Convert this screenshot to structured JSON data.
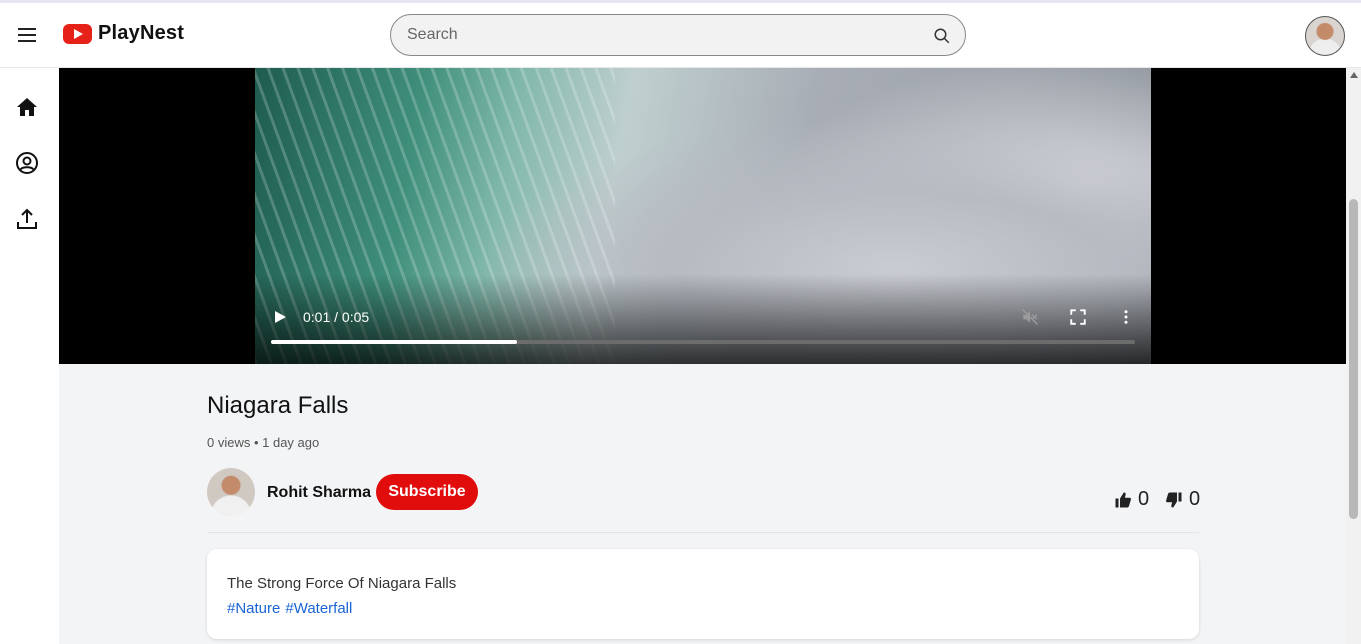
{
  "header": {
    "app_name": "PlayNest",
    "search_placeholder": "Search",
    "icons": [
      "menu-icon",
      "playnest-logo-icon",
      "search-icon",
      "user-avatar"
    ]
  },
  "sidebar": {
    "items": [
      {
        "icon": "home-icon"
      },
      {
        "icon": "profile-icon"
      },
      {
        "icon": "upload-icon"
      }
    ]
  },
  "player": {
    "time_display": "0:01 / 0:05",
    "progress": 0.285,
    "muted": true,
    "controls": [
      "play-icon",
      "mute-icon",
      "fullscreen-icon",
      "more-options-icon"
    ]
  },
  "video": {
    "title": "Niagara Falls",
    "meta": "0 views • 1 day ago",
    "channel_name": "Rohit Sharma",
    "subscribe_label": "Subscribe",
    "likes": "0",
    "dislikes": "0",
    "description": "The Strong Force Of Niagara Falls",
    "tags": [
      "#Nature",
      "#Waterfall"
    ]
  },
  "colors": {
    "brand_red": "#e62117",
    "subscribe_red": "#e10c0c",
    "tag_blue": "#1a64d6",
    "page_bg": "#f3f4f6"
  }
}
